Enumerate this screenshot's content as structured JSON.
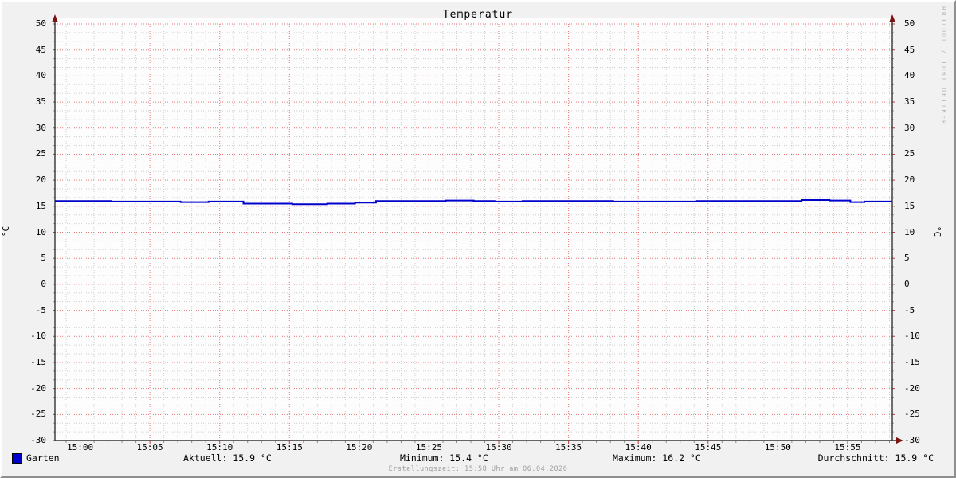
{
  "title": "Temperatur",
  "watermark": "RRDTOOL / TOBI OETIKER",
  "axis": {
    "unit_left": "°C",
    "unit_right": "°C"
  },
  "legend": {
    "series_label": "Garten",
    "aktuell": "Aktuell: 15.9 °C",
    "minimum": "Minimum: 15.4 °C",
    "maximum": "Maximum: 16.2 °C",
    "durchschnitt": "Durchschnitt: 15.9 °C"
  },
  "footer": "Erstellungszeit: 15:58 Uhr am 06.04.2026",
  "colors": {
    "line": "#0000cc",
    "swatch": "#0000cc",
    "grid_major": "#e87878",
    "grid_minor": "#cdcdcd",
    "axis": "#333333",
    "arrow": "#7d1212",
    "plot_background": "#fdfdfd",
    "background": "#f1f1f1"
  },
  "chart_data": {
    "type": "line",
    "title": "Temperatur",
    "ylabel": "°C",
    "ylim": [
      -30,
      50
    ],
    "y_major_step": 5,
    "y_minor_divisions_per_major": 3,
    "x_start": "14:58",
    "x_end": "15:58",
    "x_tick_interval_min": 5,
    "x_minor_interval_min": 1,
    "x_tick_start_offset_min": 1.8,
    "x_tick_labels": [
      "15:00",
      "15:05",
      "15:10",
      "15:15",
      "15:20",
      "15:25",
      "15:30",
      "15:35",
      "15:40",
      "15:45",
      "15:50",
      "15:55"
    ],
    "grid": {
      "on": true,
      "style": "dotted"
    },
    "legend_position": "bottom",
    "series": [
      {
        "name": "Garten",
        "color": "#0000cc",
        "unit": "°C",
        "draw_style": "step",
        "points_minutes_value": [
          [
            0,
            16.0
          ],
          [
            4,
            15.9
          ],
          [
            9,
            15.8
          ],
          [
            11,
            15.9
          ],
          [
            13.5,
            15.5
          ],
          [
            17,
            15.4
          ],
          [
            19.5,
            15.5
          ],
          [
            21.5,
            15.7
          ],
          [
            23,
            16.0
          ],
          [
            28,
            16.1
          ],
          [
            30,
            16.0
          ],
          [
            31.5,
            15.9
          ],
          [
            33.5,
            16.0
          ],
          [
            40,
            15.9
          ],
          [
            46,
            16.0
          ],
          [
            53.5,
            16.2
          ],
          [
            55.5,
            16.1
          ],
          [
            57,
            15.8
          ],
          [
            58,
            15.9
          ],
          [
            60,
            15.9
          ]
        ]
      }
    ],
    "stats": {
      "current": 15.9,
      "min": 15.4,
      "max": 16.2,
      "avg": 15.9
    }
  }
}
